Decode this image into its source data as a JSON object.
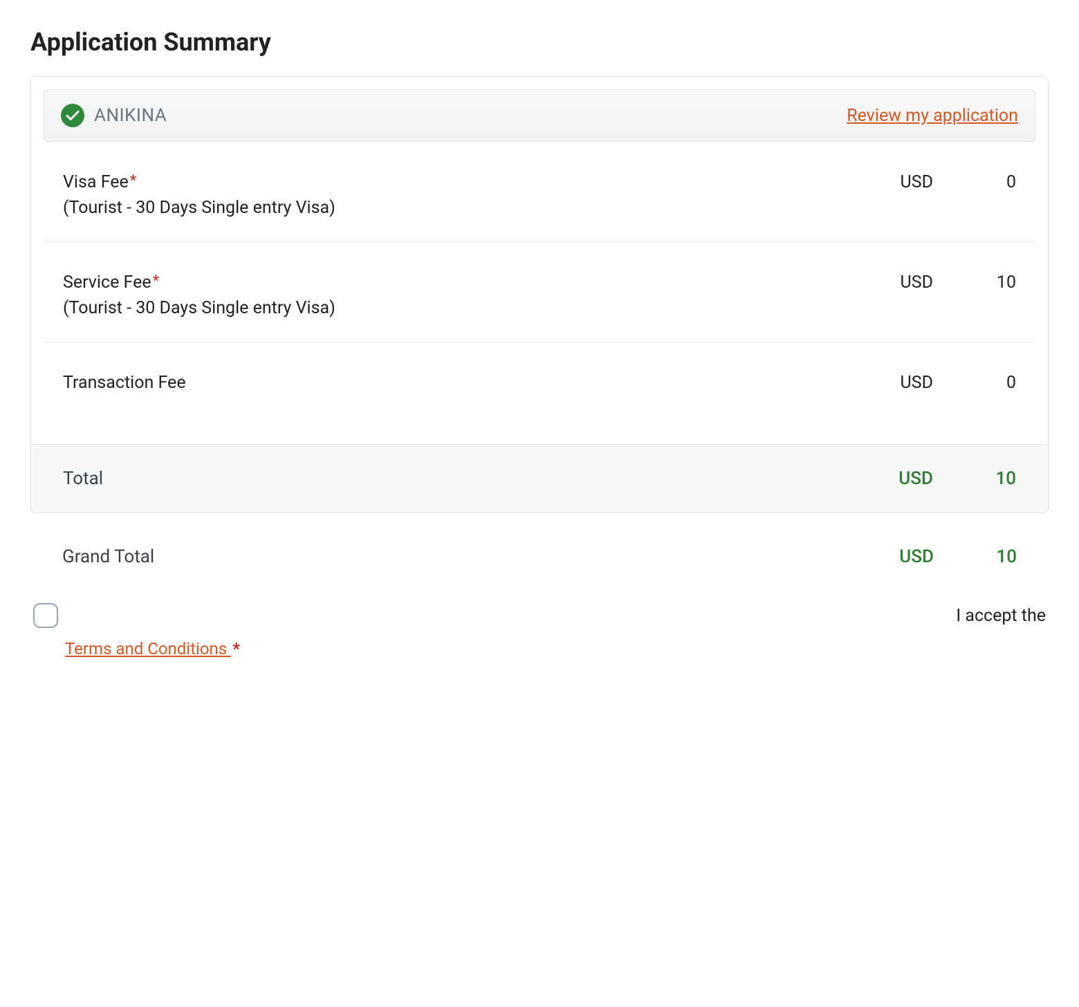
{
  "page_title": "Application Summary",
  "applicant": {
    "name": "ANIKINA",
    "review_link_text": "Review my application"
  },
  "fees": [
    {
      "label": "Visa Fee",
      "required": true,
      "subtitle": "(Tourist - 30 Days Single entry Visa)",
      "currency": "USD",
      "amount": "0"
    },
    {
      "label": "Service Fee",
      "required": true,
      "subtitle": "(Tourist - 30 Days Single entry Visa)",
      "currency": "USD",
      "amount": "10"
    },
    {
      "label": "Transaction Fee",
      "required": false,
      "subtitle": "",
      "currency": "USD",
      "amount": "0"
    }
  ],
  "total": {
    "label": "Total",
    "currency": "USD",
    "amount": "10"
  },
  "grand_total": {
    "label": "Grand Total",
    "currency": "USD",
    "amount": "10"
  },
  "terms": {
    "accept_text": "I accept the",
    "link_text": "Terms and Conditions "
  }
}
